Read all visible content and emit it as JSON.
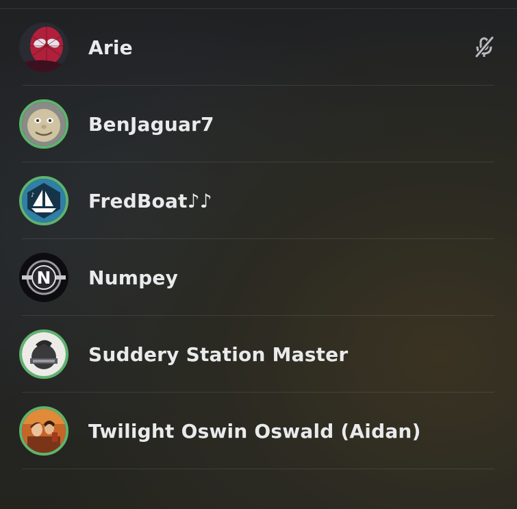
{
  "members": [
    {
      "name": "Arie",
      "avatar_icon": "spiderman-avatar-icon",
      "ring_color": "",
      "muted": true
    },
    {
      "name": "BenJaguar7",
      "avatar_icon": "smiling-face-avatar-icon",
      "ring_color": "#5fb36d",
      "muted": false
    },
    {
      "name": "FredBoat♪♪",
      "avatar_icon": "fredboat-logo-icon",
      "ring_color": "#5fb36d",
      "muted": false
    },
    {
      "name": "Numpey",
      "avatar_icon": "n-logo-avatar-icon",
      "ring_color": "",
      "muted": false
    },
    {
      "name": "Suddery Station Master",
      "avatar_icon": "station-logo-avatar-icon",
      "ring_color": "#5fb36d",
      "muted": false
    },
    {
      "name": "Twilight Oswin Oswald (Aidan)",
      "avatar_icon": "doctor-who-avatar-icon",
      "ring_color": "#5fb36d",
      "muted": false
    }
  ],
  "icons": {
    "mute": "microphone-muted-icon"
  }
}
